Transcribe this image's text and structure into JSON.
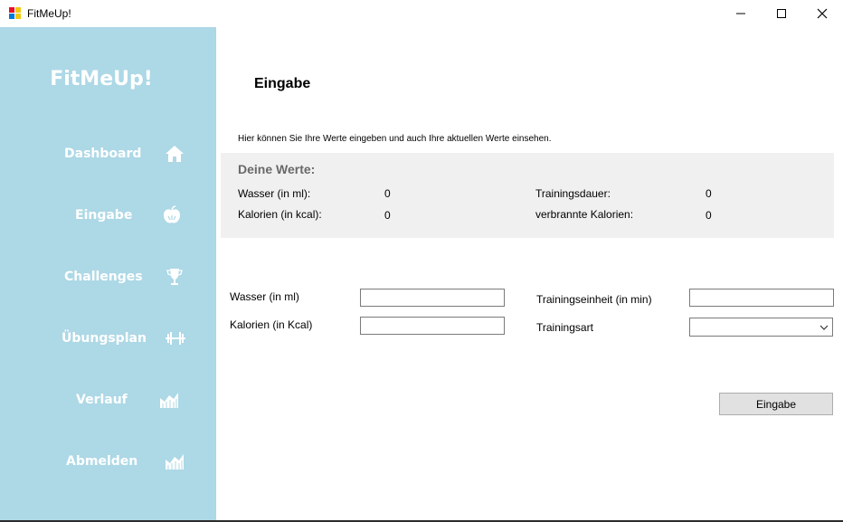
{
  "window": {
    "title": "FitMeUp!",
    "controls": [
      "minimize",
      "maximize",
      "close"
    ]
  },
  "sidebar": {
    "brand": "FitMeUp!",
    "background": "#add8e6",
    "items": [
      {
        "label": "Dashboard",
        "icon": "home-icon"
      },
      {
        "label": "Eingabe",
        "icon": "apple-icon"
      },
      {
        "label": "Challenges",
        "icon": "trophy-icon"
      },
      {
        "label": "Übungsplan",
        "icon": "dumbbell-icon"
      },
      {
        "label": "Verlauf",
        "icon": "chart-icon"
      },
      {
        "label": "Abmelden",
        "icon": "chart-icon"
      }
    ]
  },
  "main": {
    "title": "Eingabe",
    "intro": "Hier können Sie Ihre Werte eingeben und auch Ihre aktuellen Werte einsehen.",
    "values": {
      "heading": "Deine Werte:",
      "water_label": "Wasser (in ml):",
      "water_value": "0",
      "calories_label": "Kalorien (in kcal):",
      "calories_value": "0",
      "duration_label": "Trainingsdauer:",
      "duration_value": "0",
      "burned_label": "verbrannte Kalorien:",
      "burned_value": "0"
    },
    "form": {
      "water_label": "Wasser (in ml)",
      "water_value": "",
      "calories_label": "Kalorien (in Kcal)",
      "calories_value": "",
      "unit_label": "Trainingseinheit (in min)",
      "unit_value": "",
      "type_label": "Trainingsart",
      "type_value": "",
      "submit_label": "Eingabe"
    }
  }
}
